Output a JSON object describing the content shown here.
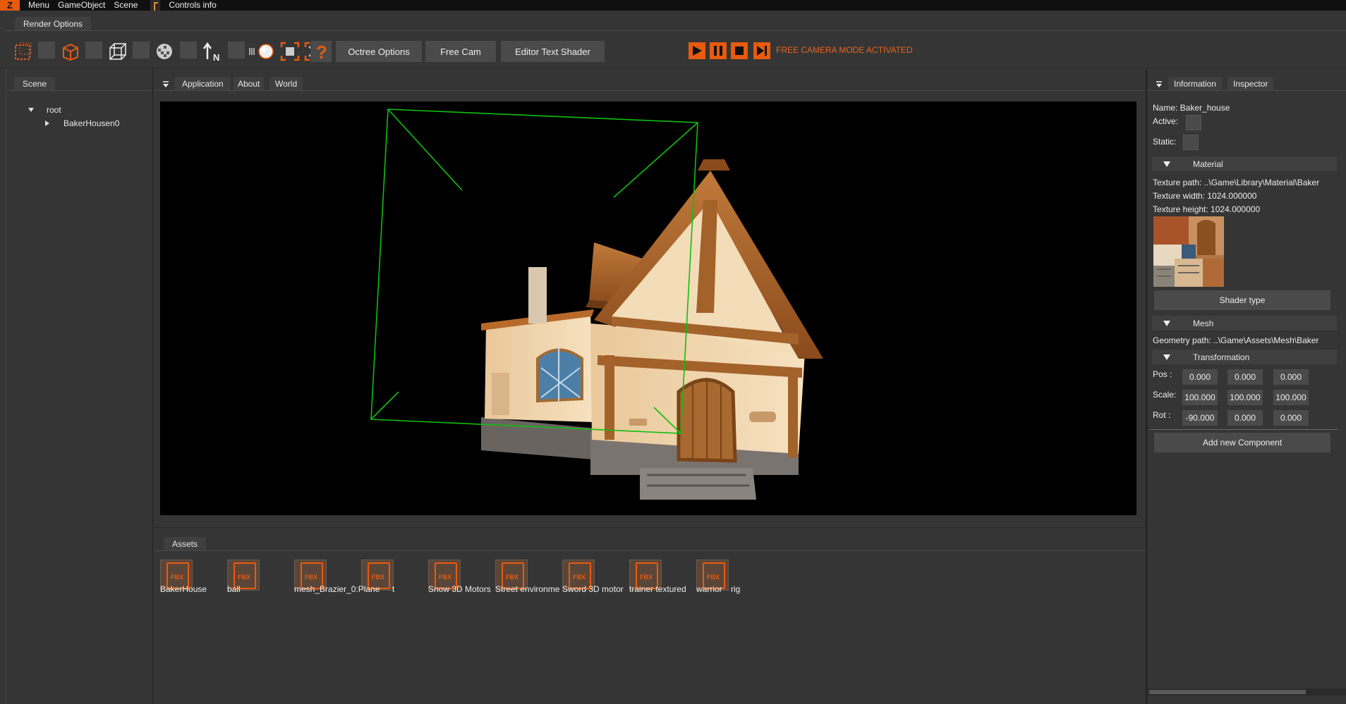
{
  "menu": {
    "logo": "Z",
    "items": [
      "Menu",
      "GameObject",
      "Scene"
    ],
    "controls_info": "Controls info"
  },
  "render_options": {
    "tab": "Render Options",
    "buttons": {
      "octree": "Octree Options",
      "free_cam": "Free Cam",
      "editor_text_shader": "Editor Text Shader"
    },
    "status": "FREE CAMERA MODE ACTIVATED",
    "accent": "#e85a0e"
  },
  "scene": {
    "tab": "Scene",
    "root": "root",
    "child": "BakerHousen0"
  },
  "center_tabs": [
    "Application",
    "About",
    "World"
  ],
  "assets": {
    "tab": "Assets",
    "items": [
      "BakerHouse",
      "ball",
      "mesh_Brazier_0:Plane",
      "t",
      "Snow 3D Motors",
      "Street environme",
      "Sword 3D motor",
      "trainer textured",
      "warrior",
      "rig"
    ],
    "icon_text": "FBX"
  },
  "inspector": {
    "tabs": [
      "Information",
      "Inspector"
    ],
    "name": "Name: Baker_house",
    "active": "Active:",
    "static": "Static:",
    "material": {
      "header": "Material",
      "texture_path": "Texture path: ..\\Game\\Library\\Material\\Baker",
      "texture_width": "Texture width: 1024.000000",
      "texture_height": "Texture height: 1024.000000",
      "shader_button": "Shader type"
    },
    "mesh": {
      "header": "Mesh",
      "geometry_path": "Geometry path: ..\\Game\\Assets\\Mesh\\Baker"
    },
    "transform": {
      "header": "Transformation",
      "pos_label": "Pos :",
      "scale_label": "Scale:",
      "rot_label": "Rot :",
      "pos": [
        "0.000",
        "0.000",
        "0.000"
      ],
      "scale": [
        "100.000",
        "100.000",
        "100.000"
      ],
      "rot": [
        "-90.000",
        "0.000",
        "0.000"
      ]
    },
    "add_component": "Add new Component"
  }
}
